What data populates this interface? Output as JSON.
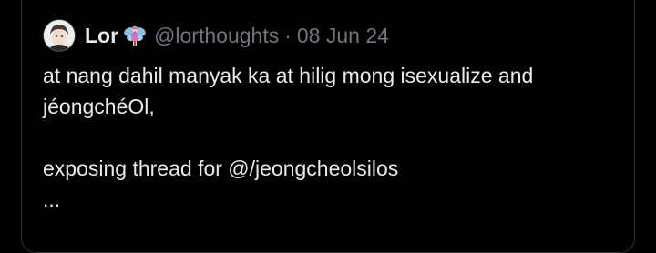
{
  "tweet": {
    "author_name": "Lor",
    "handle": "@lorthoughts",
    "separator": "·",
    "date": "08 Jun 24",
    "badge_icon": "fairy-emoji-icon",
    "text_line_1": "at nang dahil manyak ka at hilig mong isexualize and",
    "text_line_2": "jéongchéOl,",
    "text_line_3": "exposing thread for @/jeongcheolsilos",
    "truncation": "..."
  },
  "colors": {
    "background": "#000000",
    "border": "#2f3336",
    "primary_text": "#e7e9ea",
    "secondary_text": "#71767b"
  }
}
